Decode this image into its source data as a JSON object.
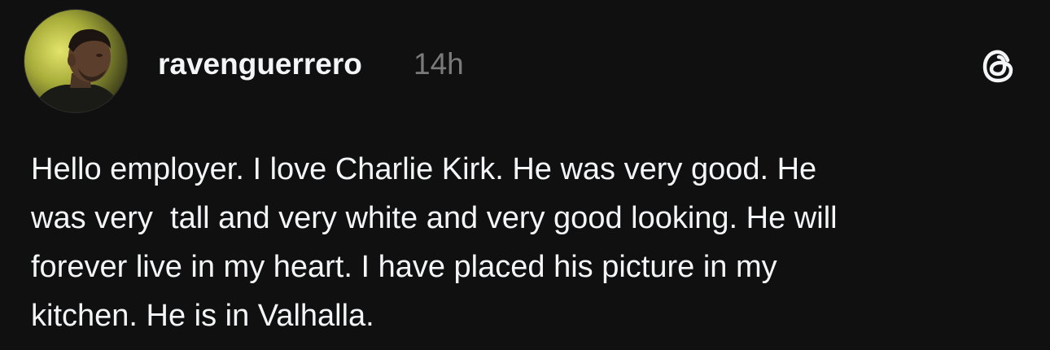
{
  "post": {
    "username": "ravenguerrero",
    "time": "14h",
    "logo_icon": "threads-logo-icon",
    "text_lines": [
      "Hello employer. I love Charlie Kirk. He was very good. He",
      "was very  tall and very white and very good looking. He will",
      "forever live in my heart. I have placed his picture in my",
      "kitchen. He is in Valhalla."
    ]
  },
  "colors": {
    "background": "#101010",
    "text": "#f3f5f7",
    "muted": "#7a7a7a"
  }
}
